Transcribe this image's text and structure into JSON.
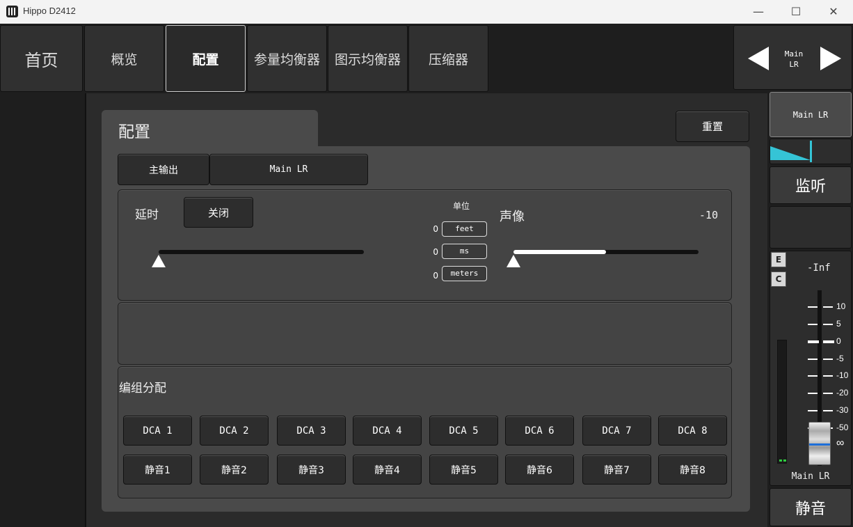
{
  "window": {
    "title": "Hippo D2412",
    "minimize": "—",
    "maximize": "☐",
    "close": "✕"
  },
  "nav": {
    "home": "首页",
    "tabs": [
      "概览",
      "配置",
      "参量均衡器",
      "图示均衡器",
      "压缩器"
    ],
    "active_tab": "配置",
    "channel_line1": "Main",
    "channel_line2": "LR"
  },
  "panel": {
    "title": "配置",
    "reset": "重置",
    "output_label": "主输出",
    "output_value": "Main LR"
  },
  "delay": {
    "label": "延时",
    "toggle": "关闭",
    "slider_value": 0
  },
  "units": {
    "title": "单位",
    "items": [
      {
        "value": "0",
        "unit": "feet"
      },
      {
        "value": "0",
        "unit": "ms"
      },
      {
        "value": "0",
        "unit": "meters"
      }
    ]
  },
  "pan": {
    "label": "声像",
    "value": "-10",
    "slider_fraction": 0.5
  },
  "group": {
    "title": "编组分配",
    "dca": [
      "DCA 1",
      "DCA 2",
      "DCA 3",
      "DCA 4",
      "DCA 5",
      "DCA 6",
      "DCA 7",
      "DCA 8"
    ],
    "mute": [
      "静音1",
      "静音2",
      "静音3",
      "静音4",
      "静音5",
      "静音6",
      "静音7",
      "静音8"
    ]
  },
  "sidebar": {
    "channel": "Main LR",
    "monitor": "监听",
    "e": "E",
    "c": "C",
    "level": "-Inf",
    "scale": [
      "10",
      "5",
      "0",
      "-5",
      "-10",
      "-20",
      "-30",
      "-50",
      "∞"
    ],
    "fader_label": "Main LR",
    "mute": "静音"
  },
  "colors": {
    "accent": "#35c4d6",
    "meter_green": "#2ecc40"
  }
}
